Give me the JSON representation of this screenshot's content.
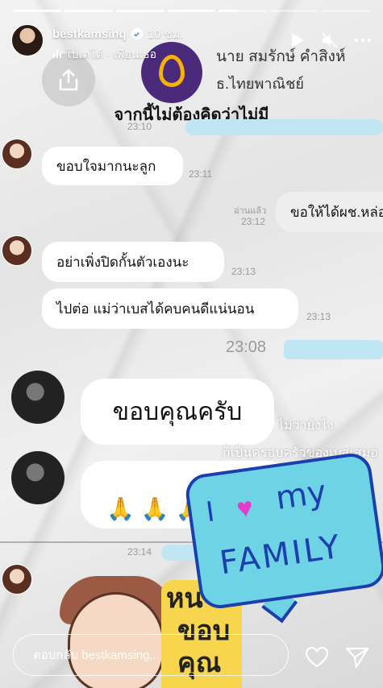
{
  "progress": [
    1,
    1,
    1,
    1,
    0.4,
    0,
    0
  ],
  "header": {
    "username": "bestkamsinq",
    "time": "10 ชม.",
    "music": "โปเตโต้ · เพื่อนเธอ"
  },
  "story": {
    "bank_name": "นาย สมรักษ์ คำสิงห์",
    "bank_label": "ธ.ไทยพาณิชย์",
    "caption": "จากนี้ไม่ต้องคิดว่าไม่มี",
    "t1": "23:10",
    "msg1": "ขอบใจมากนะลูก",
    "t2": "23:11",
    "read_label": "อ่านแล้ว",
    "t3": "23:12",
    "msg_right": "ขอให้ได้ผช.หล่อๆ",
    "msg2": "อย่าเพิ่งปิดกั้นตัวเองนะ",
    "t4": "23:13",
    "msg3": "ไปต่อ แม่ว่าเบสได้คบคนดีแน่นอน",
    "t5": "23:13",
    "t6": "23:08",
    "thanks": "ขอบคุณครับ",
    "overlay1": "ไม่ว่ายังไง",
    "overlay2": "ก็เป็นครอบครัวของเบสเสมอ",
    "hands": "🙏🙏🙏",
    "t7": "23:14",
    "sticker_i": "I",
    "sticker_heart": "♥",
    "sticker_my": "my",
    "sticker_family": "FAMILY",
    "yellow1": "หน",
    "yellow2": "ขอบ",
    "yellow3": "คุณ"
  },
  "footer": {
    "reply_placeholder": "ตอบกลับ bestkamsing..."
  },
  "icons": [
    "share-icon",
    "play-icon",
    "mute-icon",
    "verified-icon",
    "music-icon",
    "heart-icon",
    "send-icon"
  ]
}
